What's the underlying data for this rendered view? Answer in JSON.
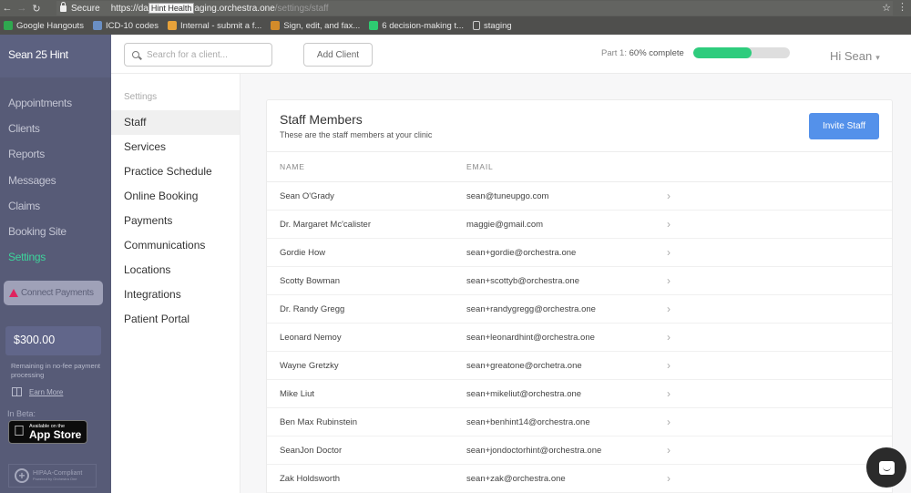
{
  "browser": {
    "secure_label": "Secure",
    "url_prefix": "https://da",
    "tooltip": "Hint Health",
    "url_host": "aging.orchestra.one",
    "url_path": "/settings/staff",
    "bookmarks": [
      {
        "label": "Google Hangouts",
        "icon": "hangouts-icon",
        "color": "#2fa84f"
      },
      {
        "label": "ICD-10 codes",
        "icon": "icd-icon",
        "color": "#6a8fc4"
      },
      {
        "label": "Internal - submit a f...",
        "icon": "internal-icon",
        "color": "#e8a23a"
      },
      {
        "label": "Sign, edit, and fax...",
        "icon": "sign-icon",
        "color": "#d38b2a"
      },
      {
        "label": "6 decision-making t...",
        "icon": "decision-icon",
        "color": "#2ecc71"
      },
      {
        "label": "staging",
        "icon": "page-icon",
        "color": "#4f4f4d"
      }
    ]
  },
  "sidebar": {
    "brand": "Sean 25 Hint",
    "items": [
      {
        "label": "Appointments",
        "active": false
      },
      {
        "label": "Clients",
        "active": false
      },
      {
        "label": "Reports",
        "active": false
      },
      {
        "label": "Messages",
        "active": false
      },
      {
        "label": "Claims",
        "active": false
      },
      {
        "label": "Booking Site",
        "active": false
      },
      {
        "label": "Settings",
        "active": true
      }
    ],
    "connect_payments": "Connect Payments",
    "balance": "$300.00",
    "remaining_text": "Remaining in no-fee payment processing",
    "earn_more": "Earn More",
    "in_beta": "In Beta:",
    "app_store_small": "Available on the",
    "app_store_big": "App Store",
    "hipaa_title": "HIPAA-Compliant",
    "hipaa_sub": "Powered by Orchestra One"
  },
  "topbar": {
    "search_placeholder": "Search for a client...",
    "add_client": "Add Client",
    "progress_prefix": "Part 1: ",
    "progress_label": "60% complete",
    "progress_percent": 60,
    "greeting": "Hi Sean",
    "accent": "#2ecc7d"
  },
  "settings_menu": {
    "title": "Settings",
    "items": [
      {
        "label": "Staff",
        "active": true
      },
      {
        "label": "Services"
      },
      {
        "label": "Practice Schedule"
      },
      {
        "label": "Online Booking"
      },
      {
        "label": "Payments"
      },
      {
        "label": "Communications"
      },
      {
        "label": "Locations"
      },
      {
        "label": "Integrations"
      },
      {
        "label": "Patient Portal"
      }
    ]
  },
  "staff": {
    "title": "Staff Members",
    "subtitle": "These are the staff members at your clinic",
    "invite_button": "Invite Staff",
    "columns": {
      "name": "NAME",
      "email": "EMAIL"
    },
    "rows": [
      {
        "name": "Sean O'Grady",
        "email": "sean@tuneupgo.com"
      },
      {
        "name": "Dr. Margaret Mc'calister",
        "email": "maggie@gmail.com"
      },
      {
        "name": "Gordie How",
        "email": "sean+gordie@orchestra.one"
      },
      {
        "name": "Scotty Bowman",
        "email": "sean+scottyb@orchestra.one"
      },
      {
        "name": "Dr. Randy Gregg",
        "email": "sean+randygregg@orchestra.one"
      },
      {
        "name": "Leonard Nemoy",
        "email": "sean+leonardhint@orchestra.one"
      },
      {
        "name": "Wayne Gretzky",
        "email": "sean+greatone@orchetra.one"
      },
      {
        "name": "Mike Liut",
        "email": "sean+mikeliut@orchestra.one"
      },
      {
        "name": "Ben Max Rubinstein",
        "email": "sean+benhint14@orchestra.one"
      },
      {
        "name": "SeanJon Doctor",
        "email": "sean+jondoctorhint@orchestra.one"
      },
      {
        "name": "Zak Holdsworth",
        "email": "sean+zak@orchestra.one"
      }
    ]
  }
}
